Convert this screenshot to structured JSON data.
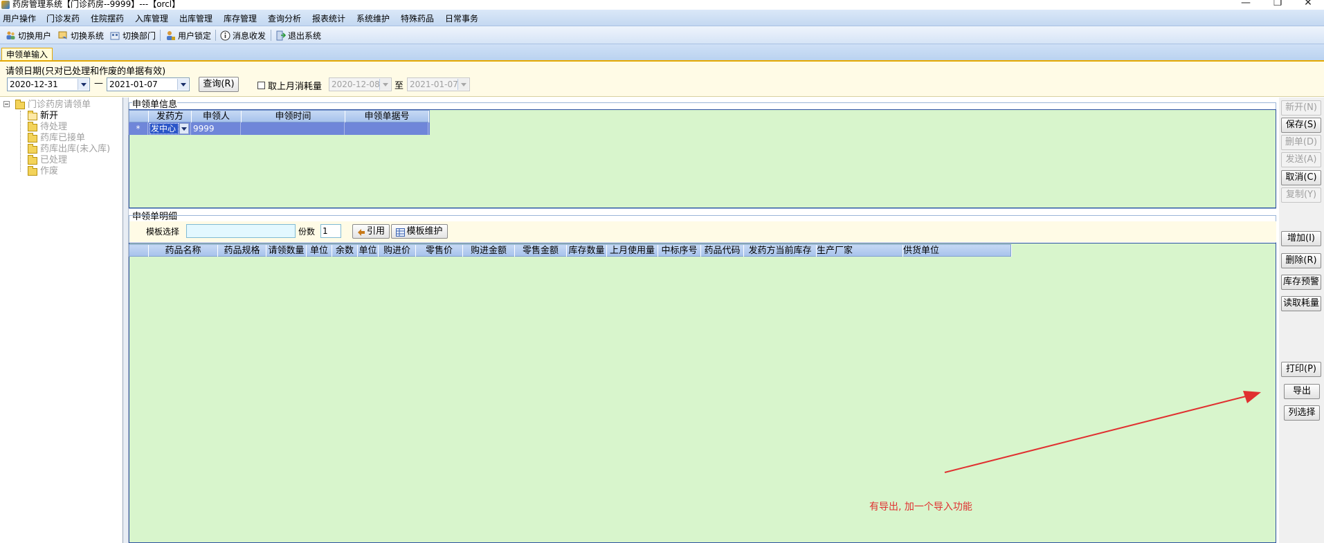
{
  "window": {
    "title": "药房管理系统【门诊药房--9999】---【orcl】",
    "minimize": "—",
    "restore": "❐",
    "close": "✕"
  },
  "menu": [
    "用户操作",
    "门诊发药",
    "住院摆药",
    "入库管理",
    "出库管理",
    "库存管理",
    "查询分析",
    "报表统计",
    "系统维护",
    "特殊药品",
    "日常事务"
  ],
  "toolbar": {
    "switch_user": "切换用户",
    "switch_system": "切换系统",
    "switch_dept": "切换部门",
    "lock_user": "用户锁定",
    "messages": "消息收发",
    "exit": "退出系统"
  },
  "tab": {
    "label": "申领单输入"
  },
  "filter": {
    "caption": "请领日期(只对已处理和作废的单据有效)",
    "date_from": "2020-12-31",
    "dash": "—",
    "date_to": "2021-01-07",
    "query_label": "查询(R)",
    "last_month_label": "取上月消耗量",
    "last_month_from": "2020-12-08",
    "to_label": "至",
    "last_month_to": "2021-01-07"
  },
  "tree": {
    "root": "门诊药房请领单",
    "items": [
      "新开",
      "待处理",
      "药库已接单",
      "药库出库(未入库)",
      "已处理",
      "作废"
    ]
  },
  "header_group": {
    "title": "申领单信息",
    "columns": [
      "发药方",
      "申领人",
      "申领时间",
      "申领单据号"
    ],
    "row": {
      "marker": "*",
      "dispenser": "发中心",
      "applicant": "9999",
      "time": "",
      "number": ""
    }
  },
  "detail_group": {
    "title": "申领单明细",
    "template_label": "模板选择",
    "template_value": "",
    "copies_label": "份数",
    "copies_value": "1",
    "quote_label": "引用",
    "template_maint_label": "模板维护",
    "columns": [
      "药品名称",
      "药品规格",
      "请领数量",
      "单位",
      "余数",
      "单位",
      "购进价",
      "零售价",
      "购进金额",
      "零售金额",
      "库存数量",
      "上月使用量",
      "中标序号",
      "药品代码",
      "发药方当前库存",
      "生产厂家",
      "供货单位"
    ]
  },
  "right_buttons": {
    "new": "新开(N)",
    "save": "保存(S)",
    "delete_bill": "删单(D)",
    "send": "发送(A)",
    "cancel": "取消(C)",
    "copy": "复制(Y)",
    "add": "增加(I)",
    "remove": "删除(R)",
    "stock_warning": "库存预警",
    "read_consumption": "读取耗量",
    "print": "打印(P)",
    "export": "导出",
    "column_select": "列选择"
  },
  "annotation": {
    "text": "有导出, 加一个导入功能",
    "color": "#e03030"
  }
}
